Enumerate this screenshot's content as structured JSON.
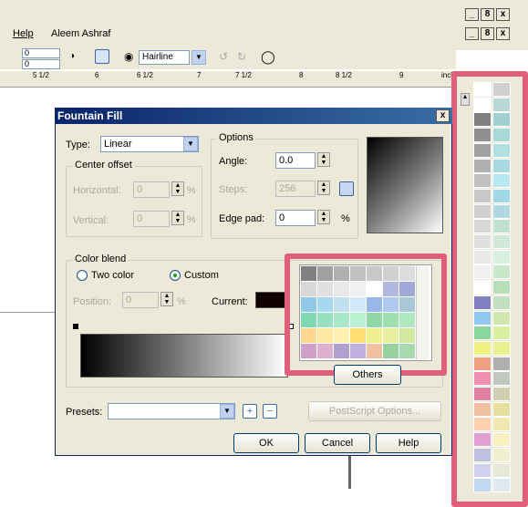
{
  "menu": {
    "help": "Help",
    "user": "Aleem Ashraf"
  },
  "window_controls": {
    "min": "_",
    "restore": "8",
    "close": "x"
  },
  "toolbar": {
    "x_value": "0",
    "y_value": "0",
    "outline_width": "Hairline"
  },
  "ruler": {
    "ticks": [
      "5 1/2",
      "6",
      "6 1/2",
      "7",
      "7 1/2",
      "8",
      "8 1/2",
      "9"
    ],
    "unit": "inches"
  },
  "dialog": {
    "title": "Fountain Fill",
    "close_glyph": "x",
    "type_label": "Type:",
    "type_value": "Linear",
    "center_offset_legend": "Center offset",
    "horizontal_label": "Horizontal:",
    "horizontal_value": "0",
    "vertical_label": "Vertical:",
    "vertical_value": "0",
    "percent": "%",
    "options_legend": "Options",
    "angle_label": "Angle:",
    "angle_value": "0.0",
    "steps_label": "Steps:",
    "steps_value": "256",
    "edge_pad_label": "Edge pad:",
    "edge_pad_value": "0",
    "color_blend_legend": "Color blend",
    "two_color_label": "Two color",
    "custom_label": "Custom",
    "position_label": "Position:",
    "position_value": "0",
    "current_label": "Current:",
    "others_label": "Others",
    "presets_label": "Presets:",
    "presets_value": "",
    "postscript_label": "PostScript Options...",
    "ok_label": "OK",
    "cancel_label": "Cancel",
    "help_label": "Help"
  },
  "colors": {
    "highlight": "#e0607a",
    "title_bar": "#0a246a",
    "current_color": "#100000"
  },
  "dialog_palette": [
    [
      "#808080",
      "#a0a0a0",
      "#b0b0b0",
      "#c0c0c0",
      "#c8c8c8",
      "#d0d0d0",
      "#dcdcdc"
    ],
    [
      "#d8d8d8",
      "#e0e0e0",
      "#e8e8e8",
      "#f0f0f0",
      "#ffffff",
      "#b0b8e0",
      "#a0a8d8"
    ],
    [
      "#90c8e8",
      "#a8d8f0",
      "#c0e0f0",
      "#d0e8f8",
      "#98b8e8",
      "#b0c8f0",
      "#a8c8d8"
    ],
    [
      "#80d8b0",
      "#98e0c0",
      "#a8e8c8",
      "#b8f0d0",
      "#90d8a8",
      "#a0e0b0",
      "#b0e8c0"
    ],
    [
      "#ffd890",
      "#ffe8a0",
      "#fff0b0",
      "#ffe070",
      "#f0f090",
      "#e8f0a0",
      "#d0e8a0"
    ],
    [
      "#d0a0c8",
      "#e0b0d0",
      "#b0a0d0",
      "#c0b0e0",
      "#f0c0a0",
      "#98d0a0",
      "#a8d8b0"
    ]
  ],
  "side_palette": [
    [
      "#ffffff",
      "#d0d0d0"
    ],
    [
      "#ffffff",
      "#b8d8d8"
    ],
    [
      "#808080",
      "#a0d0d0"
    ],
    [
      "#909090",
      "#a8d8d8"
    ],
    [
      "#a0a0a0",
      "#b0e0e0"
    ],
    [
      "#b0b0b0",
      "#a8d8e0"
    ],
    [
      "#c0c0c0",
      "#b8e8f0"
    ],
    [
      "#c8c8c8",
      "#a0d8e8"
    ],
    [
      "#d0d0d0",
      "#b0d8e0"
    ],
    [
      "#d8d8d8",
      "#c0e0d0"
    ],
    [
      "#e0e0e0",
      "#d0e8d8"
    ],
    [
      "#e8e8e8",
      "#d8f0e0"
    ],
    [
      "#f0f0f0",
      "#c8e8c8"
    ],
    [
      "#ffffff",
      "#b8e0b8"
    ],
    [
      "#8080c0",
      "#c0e0c0"
    ],
    [
      "#90c8f0",
      "#d0e8b0"
    ],
    [
      "#88d8a0",
      "#d8f0a0"
    ],
    [
      "#f0f080",
      "#e8f090"
    ],
    [
      "#f0a080",
      "#b0b0b0"
    ],
    [
      "#f090b0",
      "#c0c8c0"
    ],
    [
      "#e080a0",
      "#d0d0b0"
    ],
    [
      "#f0c0a0",
      "#e8e0a0"
    ],
    [
      "#ffd0b0",
      "#f0e8b0"
    ],
    [
      "#e0a0d0",
      "#f8f0c0"
    ],
    [
      "#c0c0e0",
      "#f0f0d0"
    ],
    [
      "#d0d0f0",
      "#e8e8d8"
    ],
    [
      "#c0d8f0",
      "#e0e8f0"
    ]
  ]
}
